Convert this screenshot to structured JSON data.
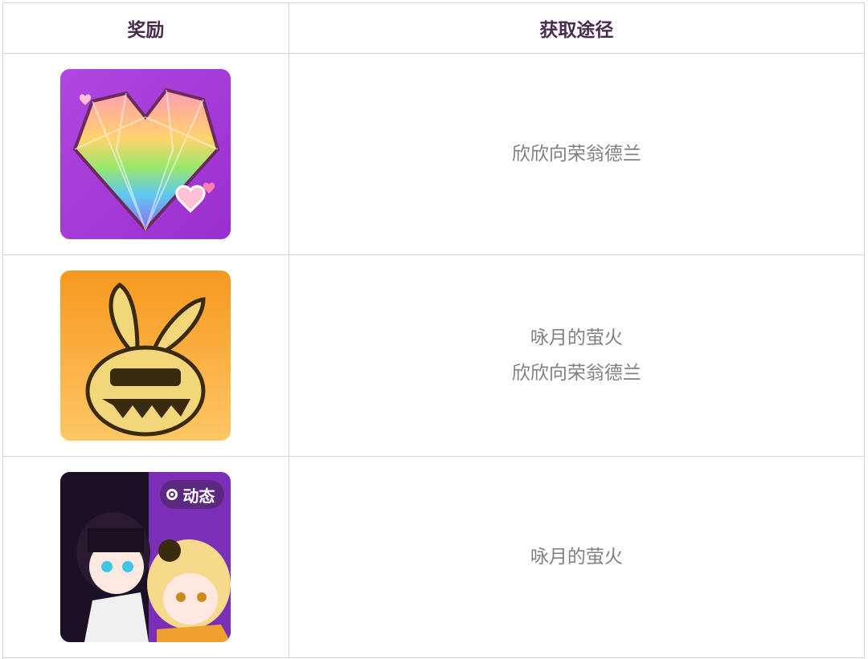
{
  "table": {
    "headers": {
      "reward": "奖励",
      "source": "获取途径"
    },
    "rows": [
      {
        "icon": "rainbow-heart-gem-icon",
        "icon_bg": "#a43fd8",
        "sources": [
          "欣欣向荣翁德兰"
        ]
      },
      {
        "icon": "golden-bunny-medal-icon",
        "icon_bg": "#f5a623",
        "sources": [
          "咏月的萤火",
          "欣欣向荣翁德兰"
        ]
      },
      {
        "icon": "chibi-characters-avatar-icon",
        "icon_bg": "#7b2fb8",
        "badge": "动态",
        "sources": [
          "咏月的萤火"
        ]
      }
    ]
  },
  "colors": {
    "header_text": "#4a2a4f",
    "body_text": "#808080",
    "border": "#d4d4d4"
  }
}
